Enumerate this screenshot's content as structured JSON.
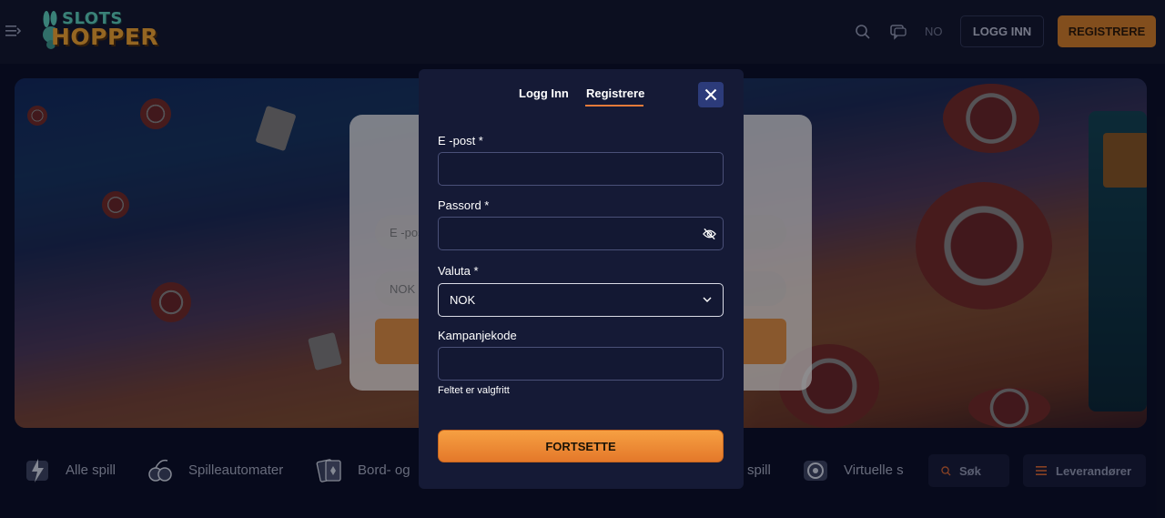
{
  "header": {
    "logo_top": "SLOTS",
    "logo_bottom": "HOPPER",
    "lang": "NO",
    "login_label": "LOGG INN",
    "register_label": "REGISTRERE"
  },
  "hero": {
    "email_placeholder": "E -post",
    "currency_value": "NOK"
  },
  "categories": {
    "items": [
      {
        "label": "Alle spill",
        "icon": "lightning-icon"
      },
      {
        "label": "Spilleautomater",
        "icon": "cherry-icon"
      },
      {
        "label": "Bord- og",
        "icon": "cards-icon"
      },
      {
        "label": "spill",
        "icon": "game-icon"
      },
      {
        "label": "Virtuelle s",
        "icon": "virtual-icon"
      }
    ],
    "search_label": "Søk",
    "providers_label": "Leverandører"
  },
  "modal": {
    "tab_login": "Logg Inn",
    "tab_register": "Registrere",
    "email_label": "E -post *",
    "email_value": "",
    "password_label": "Passord *",
    "password_value": "",
    "currency_label": "Valuta *",
    "currency_value": "NOK",
    "promo_label": "Kampanjekode",
    "promo_value": "",
    "promo_hint": "Feltet er valgfritt",
    "submit_label": "FORTSETTE"
  },
  "colors": {
    "accent": "#e47a3a",
    "modal_bg": "#151a36",
    "page_bg": "#0a0d22"
  }
}
